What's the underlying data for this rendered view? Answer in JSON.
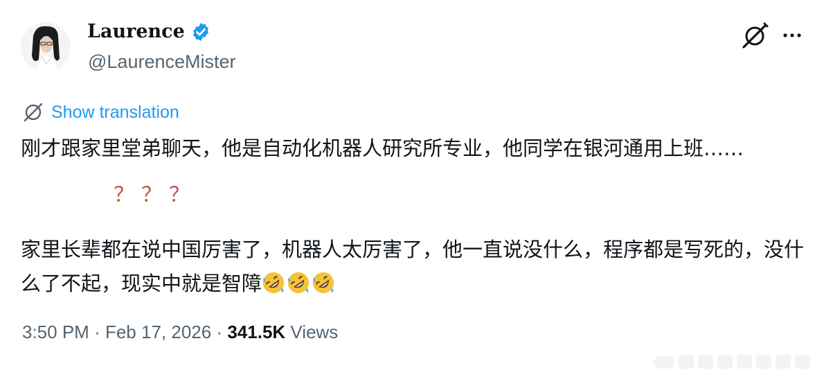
{
  "author": {
    "name": "Laurence",
    "handle": "@LaurenceMister",
    "verified_color": "#1d9bf0"
  },
  "header_actions": {
    "grok_icon": "grok-icon",
    "more_icon": "more-icon"
  },
  "translation": {
    "label": "Show translation",
    "icon": "globe-translate-icon"
  },
  "tweet": {
    "paragraph1": "刚才跟家里堂弟聊天，他是自动化机器人研究所专业，他同学在银河通用上班……",
    "question_marks": "？？？",
    "paragraph2": "家里长辈都在说中国厉害了，机器人太厉害了，他一直说没什么，程序都是写死的，没什么了不起，现实中就是智障",
    "emoji": "rolling-on-floor-laughing-emoji"
  },
  "meta": {
    "time": "3:50 PM",
    "date": "Feb 17, 2026",
    "views_count": "341.5K",
    "views_label": "Views",
    "separator": "·"
  },
  "colors": {
    "text": "#0f1419",
    "secondary": "#536471",
    "link": "#1d9bf0",
    "question_mark": "#c0554a"
  }
}
